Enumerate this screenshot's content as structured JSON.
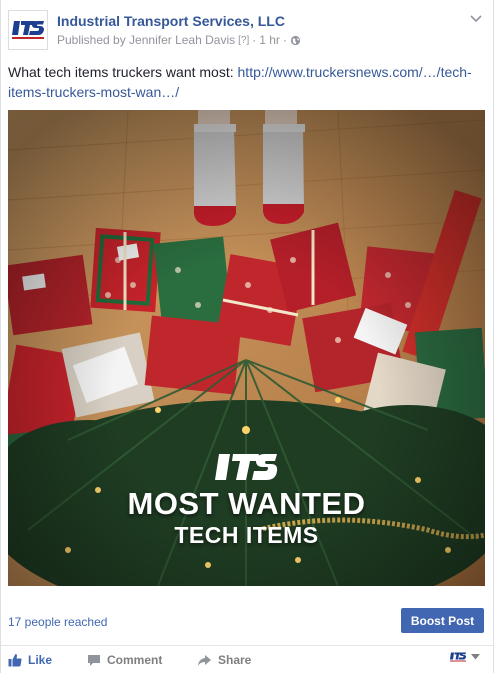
{
  "post": {
    "page_name": "Industrial Transport Services, LLC",
    "published_by": "Published by Jennifer Leah Davis",
    "help_marker": "[?]",
    "separator": "·",
    "time": "1 hr",
    "text_prefix": "What tech items truckers want most: ",
    "link_text": "http://www.truckersnews.com/…/tech-items-truckers-most-wan…/",
    "image": {
      "logo_text": "ITS",
      "title": "MOST WANTED",
      "subtitle": "TECH ITEMS"
    }
  },
  "stats": {
    "reach_text": "17 people reached",
    "boost_label": "Boost Post"
  },
  "actions": {
    "like_label": "Like",
    "comment_label": "Comment",
    "share_label": "Share"
  },
  "colors": {
    "link_blue": "#365899",
    "button_blue": "#4267b2",
    "meta_gray": "#90949c",
    "action_gray": "#7f7f7f"
  }
}
